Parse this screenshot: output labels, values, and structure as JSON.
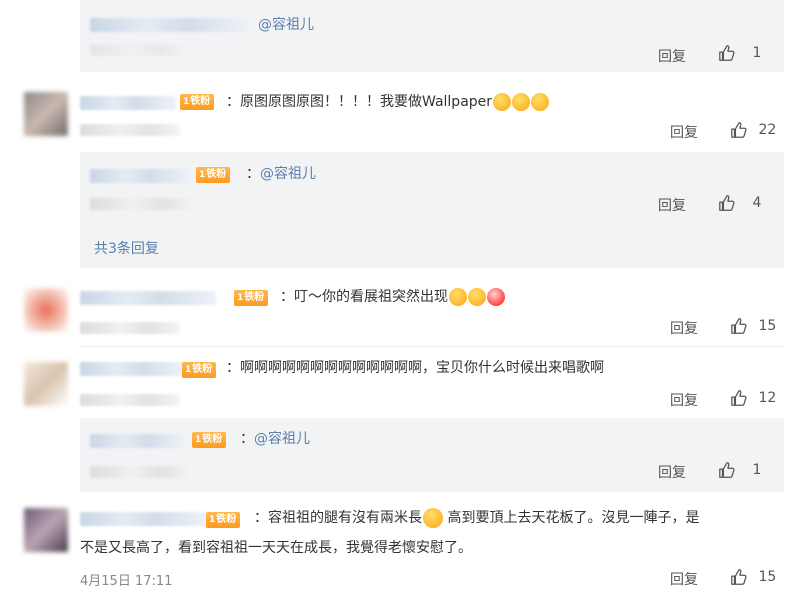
{
  "reply_label": "回复",
  "comments": [
    {
      "id": "r0",
      "type": "reply",
      "mention": "@容祖儿",
      "likes": "1"
    },
    {
      "id": "c1",
      "type": "comment",
      "text": "：原图原图原图！！！！我要做Wallpaper",
      "likes": "22"
    },
    {
      "id": "r1",
      "type": "reply",
      "mention": "@容祖儿",
      "likes": "4"
    },
    {
      "id": "c2",
      "type": "comment",
      "text": "：叮～你的看展祖突然出现",
      "likes": "15"
    },
    {
      "id": "c3",
      "type": "comment",
      "text": "：啊啊啊啊啊啊啊啊啊啊啊啊啊，宝贝你什么时候出来唱歌啊",
      "likes": "12"
    },
    {
      "id": "r3",
      "type": "reply",
      "mention": "@容祖儿",
      "likes": "1"
    },
    {
      "id": "c4",
      "type": "comment",
      "text_line1_a": "：容祖祖的腿有沒有兩米長",
      "text_line1_b": " 高到要頂上去天花板了。沒見一陣子，是",
      "text_line2": "不是又長高了，看到容祖祖一天天在成長，我覺得老懷安慰了。",
      "timestamp": "4月15日 17:11",
      "likes": "15"
    }
  ],
  "total_replies_link": "共3条回复",
  "fan_badge": {
    "level": "1",
    "label": "铁粉"
  },
  "colors": {
    "mention": "#5b7fad",
    "reply_box": "#f2f3f5",
    "badge": "#ff9a1f"
  },
  "icons": [
    "thumb-up-icon",
    "emoji-icon",
    "fan-badge-icon"
  ]
}
